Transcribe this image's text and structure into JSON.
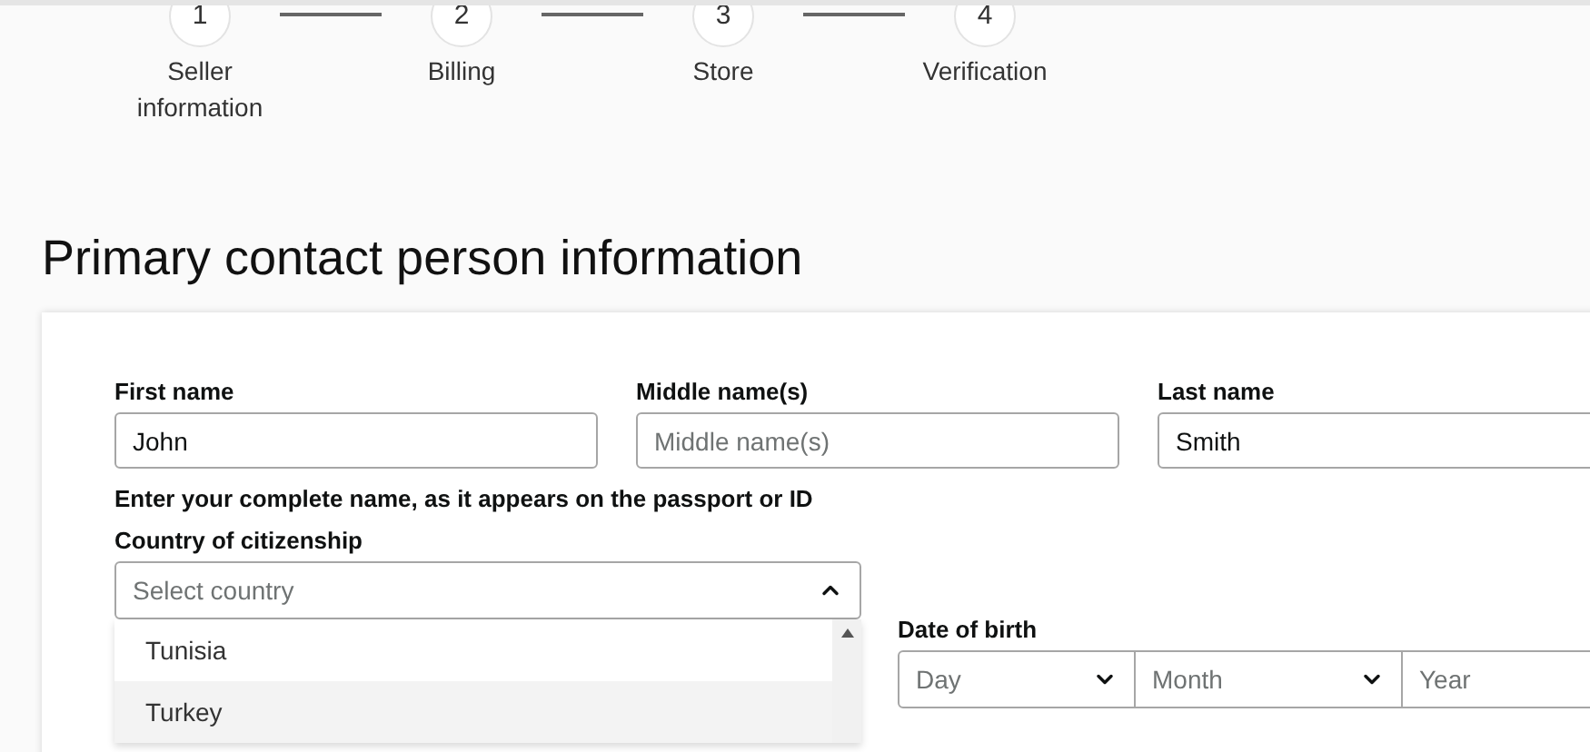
{
  "steps": [
    {
      "number": "1",
      "label": "Seller information"
    },
    {
      "number": "2",
      "label": "Billing"
    },
    {
      "number": "3",
      "label": "Store"
    },
    {
      "number": "4",
      "label": "Verification"
    }
  ],
  "heading": "Primary contact person information",
  "name_fields": [
    {
      "label": "First name",
      "value": "John"
    },
    {
      "label": "Middle name(s)",
      "placeholder": "Middle name(s)"
    },
    {
      "label": "Last name",
      "value": "Smith"
    }
  ],
  "name_hint": "Enter your complete name, as it appears on the passport or ID",
  "citizenship": {
    "label": "Country of citizenship",
    "placeholder": "Select country",
    "expanded": true,
    "options": [
      {
        "label": "Tunisia",
        "highlighted": false
      },
      {
        "label": "Turkey",
        "highlighted": true
      }
    ]
  },
  "date_of_birth": {
    "label": "Date of birth",
    "parts": [
      {
        "placeholder": "Day",
        "kind": "select"
      },
      {
        "placeholder": "Month",
        "kind": "select"
      },
      {
        "placeholder": "Year",
        "kind": "input"
      }
    ]
  }
}
